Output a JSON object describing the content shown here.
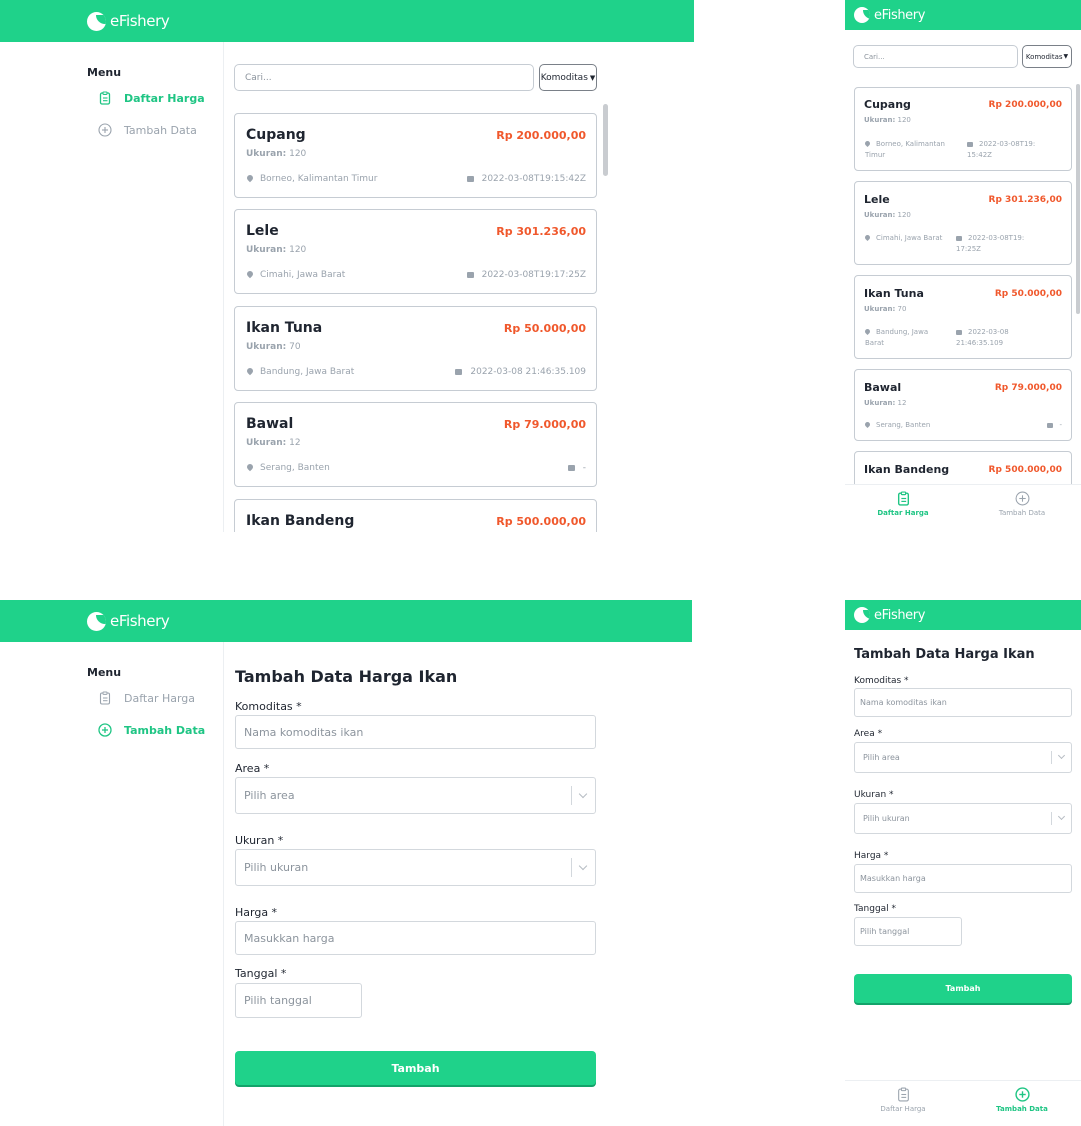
{
  "brand": {
    "name": "eFishery"
  },
  "menu_heading": "Menu",
  "nav": {
    "daftar": "Daftar Harga",
    "tambah": "Tambah Data"
  },
  "search": {
    "placeholder": "Cari..."
  },
  "filter": {
    "selected": "Komoditas"
  },
  "currency": "Rp",
  "items": [
    {
      "komoditas": "Cupang",
      "ukuran": "120",
      "price": "Rp 200.000,00",
      "area": "Borneo, Kalimantan Timur",
      "tanggal": "2022-03-08T19:15:42Z"
    },
    {
      "komoditas": "Lele",
      "ukuran": "120",
      "price": "Rp 301.236,00",
      "area": "Cimahi, Jawa Barat",
      "tanggal": "2022-03-08T19:17:25Z"
    },
    {
      "komoditas": "Ikan Tuna",
      "ukuran": "70",
      "price": "Rp 50.000,00",
      "area": "Bandung, Jawa Barat",
      "tanggal": "2022-03-08 21:46:35.109"
    },
    {
      "komoditas": "Bawal",
      "ukuran": "12",
      "price": "Rp 79.000,00",
      "area": "Serang, Banten",
      "tanggal": "-"
    },
    {
      "komoditas": "Ikan Bandeng",
      "ukuran": "",
      "price": "Rp 500.000,00",
      "area": "",
      "tanggal": ""
    }
  ],
  "ukuran_label": "Ukuran:",
  "form": {
    "title": "Tambah Data Harga Ikan",
    "komoditas": {
      "label": "Komoditas *",
      "placeholder": "Nama komoditas ikan"
    },
    "area": {
      "label": "Area *",
      "placeholder": "Pilih area"
    },
    "ukuran": {
      "label": "Ukuran *",
      "placeholder": "Pilih ukuran"
    },
    "harga": {
      "label": "Harga *",
      "placeholder": "Masukkan harga"
    },
    "tanggal": {
      "label": "Tanggal *",
      "placeholder": "Pilih tanggal"
    },
    "submit": "Tambah"
  },
  "colors": {
    "brand": "#1fd28a",
    "price": "#f0582c",
    "muted": "#9aa3ad"
  },
  "icons": {
    "daftar": "clipboard-list-icon",
    "tambah": "plus-circle-icon",
    "location": "map-pin-icon",
    "date": "calendar-icon"
  }
}
